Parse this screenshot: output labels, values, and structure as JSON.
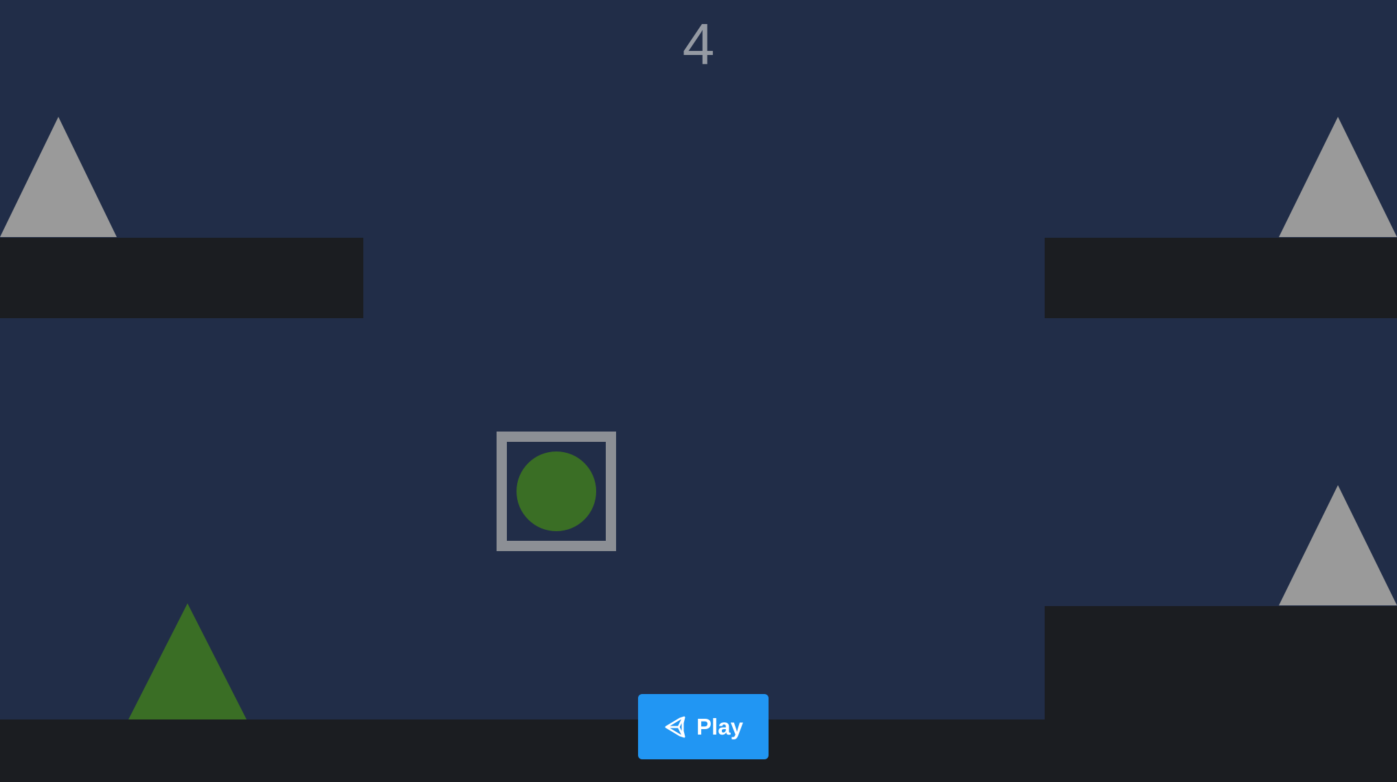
{
  "hud": {
    "score": "4"
  },
  "play_button": {
    "label": "Play",
    "icon": "unity-logo-icon"
  },
  "colors": {
    "background": "#212d48",
    "platform": "#1b1d21",
    "spike_gray": "#9a9a9a",
    "spike_green": "#3a6e25",
    "player_frame": "#8c8f95",
    "player_ball": "#3a6e25",
    "score_text": "#959aa3",
    "button": "#2196f3"
  }
}
